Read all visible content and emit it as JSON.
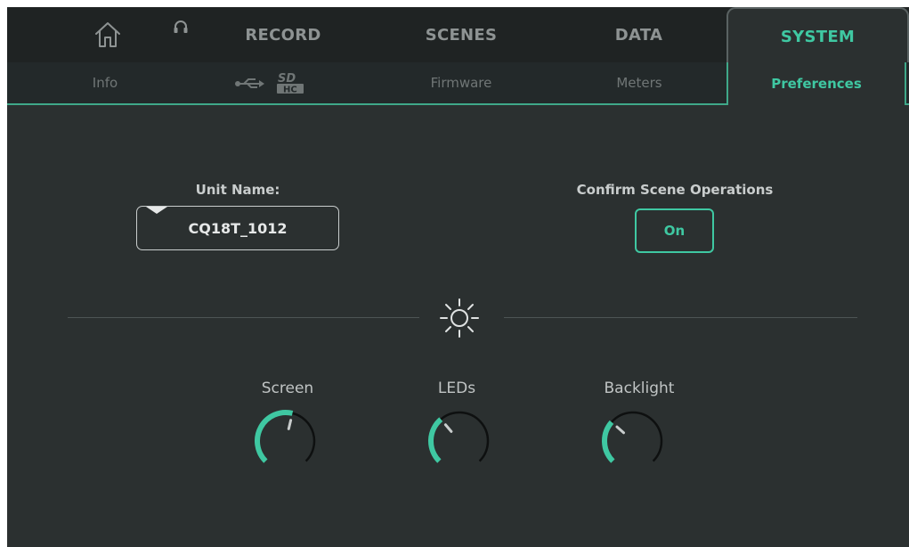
{
  "top_tabs": [
    {
      "label": "RECORD"
    },
    {
      "label": "SCENES"
    },
    {
      "label": "DATA"
    },
    {
      "label": "SYSTEM",
      "active": true
    }
  ],
  "sub_tabs": [
    {
      "label": "Info"
    },
    {
      "label": "Firmware"
    },
    {
      "label": "Meters"
    },
    {
      "label": "Preferences",
      "active": true
    }
  ],
  "icons": {
    "home": "home-icon",
    "headphones": "headphones-icon",
    "usb": "usb-icon",
    "sdhc": "sdhc-icon",
    "brightness": "sun-icon"
  },
  "preferences": {
    "unit_name_label": "Unit Name:",
    "unit_name_value": "CQ18T_1012",
    "confirm_label": "Confirm Scene Operations",
    "confirm_value": "On"
  },
  "brightness": {
    "screen_label": "Screen",
    "screen_level": 0.55,
    "leds_label": "LEDs",
    "leds_level": 0.35,
    "backlight_label": "Backlight",
    "backlight_level": 0.32
  },
  "colors": {
    "accent": "#3fc8a2",
    "background": "#2b3030"
  }
}
